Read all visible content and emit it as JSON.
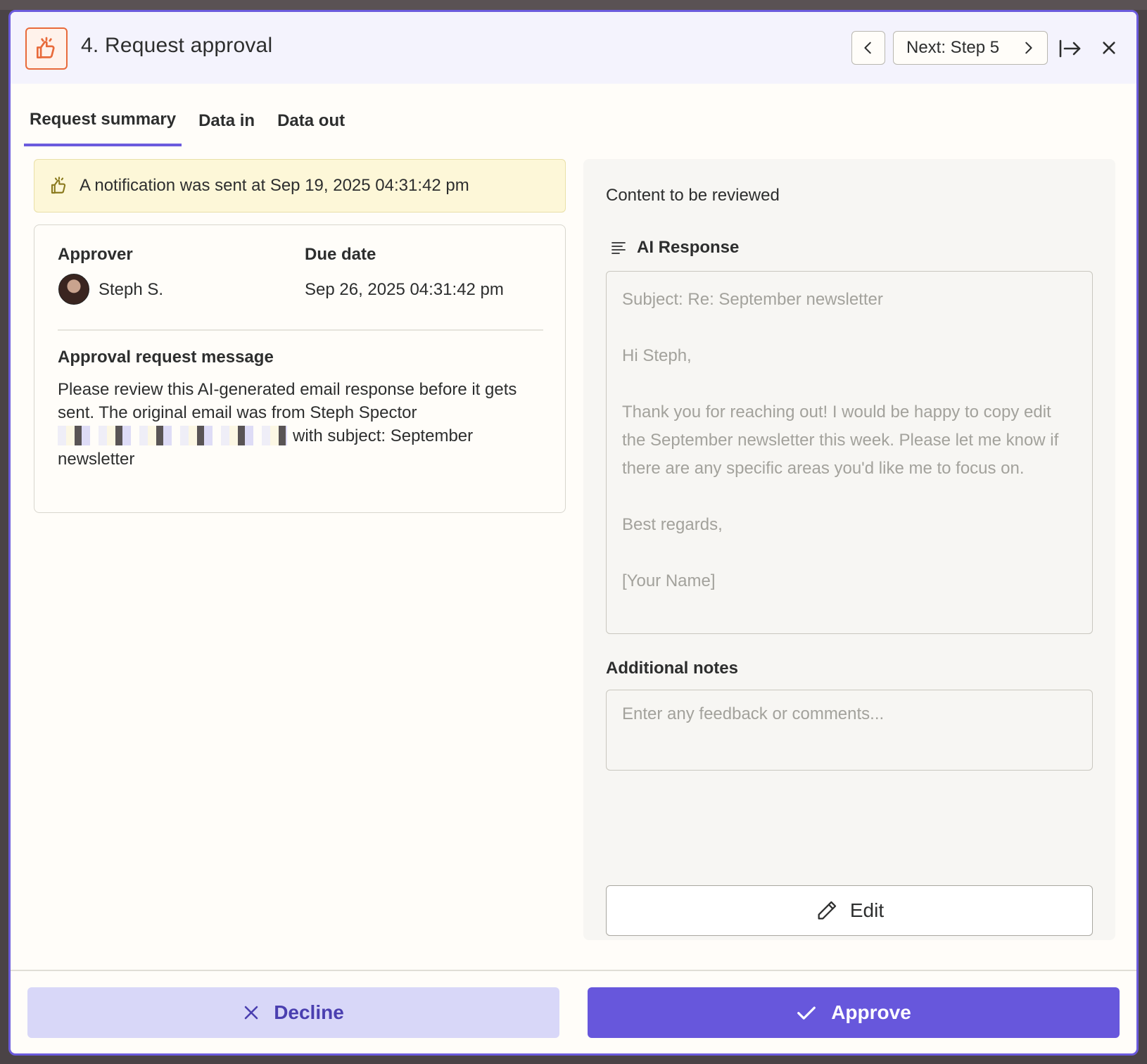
{
  "header": {
    "title": "4. Request approval",
    "next_label": "Next: Step 5"
  },
  "tabs": [
    {
      "label": "Request summary",
      "active": true
    },
    {
      "label": "Data in",
      "active": false
    },
    {
      "label": "Data out",
      "active": false
    }
  ],
  "notice": {
    "text": "A notification was sent at Sep 19, 2025 04:31:42 pm"
  },
  "summary": {
    "approver_label": "Approver",
    "approver_name": "Steph S.",
    "due_label": "Due date",
    "due_value": "Sep 26, 2025 04:31:42 pm",
    "message_label": "Approval request message",
    "message_before": "Please review this AI-generated email response before it gets sent. The original email was from Steph Spector",
    "message_after": "with subject: September newsletter"
  },
  "review": {
    "title": "Content to be reviewed",
    "field_label": "AI Response",
    "ai_response": "Subject: Re: September newsletter\n\nHi Steph,\n\nThank you for reaching out! I would be happy to copy edit the September newsletter this week. Please let me know if there are any specific areas you'd like me to focus on.\n\nBest regards,\n\n[Your Name]",
    "notes_label": "Additional notes",
    "notes_placeholder": "Enter any feedback or comments...",
    "edit_label": "Edit"
  },
  "footer": {
    "decline_label": "Decline",
    "approve_label": "Approve"
  },
  "colors": {
    "accent": "#6757dc",
    "decline_bg": "#d8d7f8",
    "notice_bg": "#fdf7d8",
    "app_icon": "#e86a3a"
  },
  "icons": [
    "thumbs-up-sparkle-icon",
    "chevron-left-icon",
    "chevron-right-icon",
    "expand-panel-icon",
    "close-icon",
    "text-lines-icon",
    "pencil-icon",
    "x-icon",
    "check-icon"
  ]
}
